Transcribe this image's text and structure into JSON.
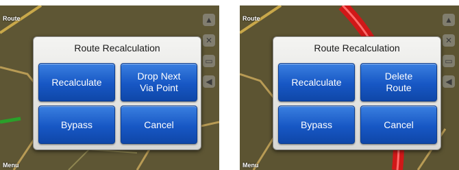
{
  "screens": [
    {
      "map": {
        "route_tag": "Route",
        "menu_tag": "Menu"
      },
      "dialog": {
        "title": "Route Recalculation",
        "buttons": [
          "Recalculate",
          "Drop Next\nVia Point",
          "Bypass",
          "Cancel"
        ]
      }
    },
    {
      "map": {
        "route_tag": "Route",
        "menu_tag": "Menu"
      },
      "dialog": {
        "title": "Route Recalculation",
        "buttons": [
          "Recalculate",
          "Delete\nRoute",
          "Bypass",
          "Cancel"
        ]
      }
    }
  ],
  "side_icons": [
    "compass-icon",
    "mute-icon",
    "battery-icon",
    "speaker-icon"
  ],
  "colors": {
    "button": "#1757c4",
    "dialog": "#e6e6e3",
    "route_red": "#d01818",
    "map": "#5a5232"
  }
}
